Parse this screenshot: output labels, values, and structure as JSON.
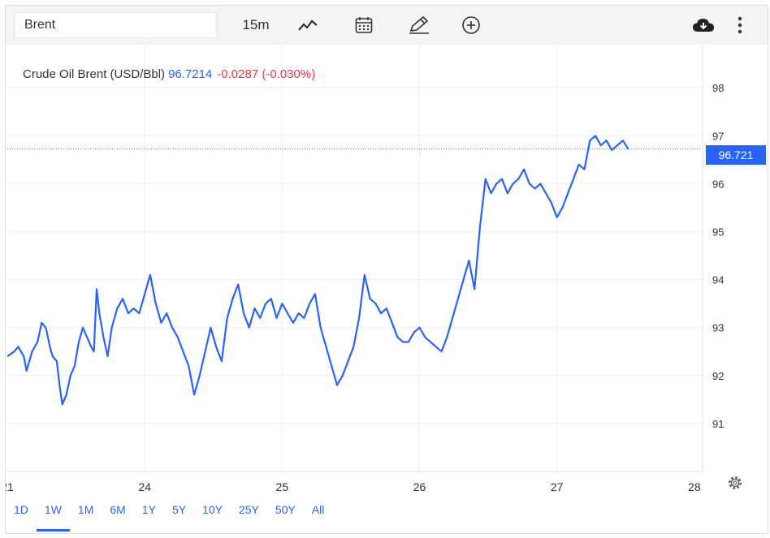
{
  "toolbar": {
    "symbol": "Brent",
    "interval": "15m",
    "icons": [
      "chart-type-icon",
      "calendar-icon",
      "pencil-icon",
      "add-circle-icon",
      "cloud-download-icon",
      "more-vertical-icon"
    ]
  },
  "legend": {
    "name": "Crude Oil Brent (USD/Bbl)",
    "price": "96.7214",
    "change": "-0.0287 (-0.030%)"
  },
  "price_label": "96.721",
  "colors": {
    "line": "#2962ff",
    "negative": "#f23645",
    "grid": "#eeeeee"
  },
  "ranges": [
    "1D",
    "1W",
    "1M",
    "6M",
    "1Y",
    "5Y",
    "10Y",
    "25Y",
    "50Y",
    "All"
  ],
  "active_range": "1W",
  "chart_data": {
    "type": "line",
    "title": "Crude Oil Brent (USD/Bbl)",
    "x_ticks": [
      "21",
      "24",
      "25",
      "26",
      "27",
      "28"
    ],
    "y_ticks": [
      "91",
      "92",
      "93",
      "94",
      "95",
      "96",
      "97",
      "98"
    ],
    "ylim": [
      90.0,
      98.9
    ],
    "xlim": [
      0,
      5.06
    ],
    "last_value": 96.721,
    "grid": true,
    "series": [
      {
        "values": [
          [
            0.0,
            92.4
          ],
          [
            0.05,
            92.5
          ],
          [
            0.08,
            92.6
          ],
          [
            0.12,
            92.4
          ],
          [
            0.14,
            92.1
          ],
          [
            0.18,
            92.5
          ],
          [
            0.22,
            92.7
          ],
          [
            0.25,
            93.1
          ],
          [
            0.28,
            93.0
          ],
          [
            0.31,
            92.6
          ],
          [
            0.33,
            92.4
          ],
          [
            0.36,
            92.3
          ],
          [
            0.38,
            91.8
          ],
          [
            0.4,
            91.4
          ],
          [
            0.43,
            91.6
          ],
          [
            0.46,
            92.0
          ],
          [
            0.49,
            92.2
          ],
          [
            0.52,
            92.7
          ],
          [
            0.55,
            93.0
          ],
          [
            0.58,
            92.8
          ],
          [
            0.61,
            92.6
          ],
          [
            0.63,
            92.5
          ],
          [
            0.65,
            93.8
          ],
          [
            0.67,
            93.3
          ],
          [
            0.7,
            92.8
          ],
          [
            0.73,
            92.4
          ],
          [
            0.76,
            93.0
          ],
          [
            0.8,
            93.4
          ],
          [
            0.84,
            93.6
          ],
          [
            0.88,
            93.3
          ],
          [
            0.92,
            93.4
          ],
          [
            0.96,
            93.3
          ],
          [
            1.0,
            93.7
          ],
          [
            1.04,
            94.1
          ],
          [
            1.08,
            93.5
          ],
          [
            1.12,
            93.1
          ],
          [
            1.16,
            93.3
          ],
          [
            1.2,
            93.0
          ],
          [
            1.24,
            92.8
          ],
          [
            1.28,
            92.5
          ],
          [
            1.32,
            92.2
          ],
          [
            1.36,
            91.6
          ],
          [
            1.4,
            92.0
          ],
          [
            1.44,
            92.5
          ],
          [
            1.48,
            93.0
          ],
          [
            1.52,
            92.6
          ],
          [
            1.56,
            92.3
          ],
          [
            1.6,
            93.2
          ],
          [
            1.64,
            93.6
          ],
          [
            1.68,
            93.9
          ],
          [
            1.72,
            93.3
          ],
          [
            1.76,
            93.0
          ],
          [
            1.8,
            93.4
          ],
          [
            1.84,
            93.2
          ],
          [
            1.88,
            93.5
          ],
          [
            1.92,
            93.6
          ],
          [
            1.96,
            93.2
          ],
          [
            2.0,
            93.5
          ],
          [
            2.04,
            93.3
          ],
          [
            2.08,
            93.1
          ],
          [
            2.12,
            93.3
          ],
          [
            2.16,
            93.2
          ],
          [
            2.2,
            93.5
          ],
          [
            2.24,
            93.7
          ],
          [
            2.28,
            93.0
          ],
          [
            2.32,
            92.6
          ],
          [
            2.36,
            92.2
          ],
          [
            2.4,
            91.8
          ],
          [
            2.44,
            92.0
          ],
          [
            2.48,
            92.3
          ],
          [
            2.52,
            92.6
          ],
          [
            2.56,
            93.2
          ],
          [
            2.6,
            94.1
          ],
          [
            2.64,
            93.6
          ],
          [
            2.68,
            93.5
          ],
          [
            2.72,
            93.3
          ],
          [
            2.76,
            93.4
          ],
          [
            2.8,
            93.1
          ],
          [
            2.84,
            92.8
          ],
          [
            2.88,
            92.7
          ],
          [
            2.92,
            92.7
          ],
          [
            2.96,
            92.9
          ],
          [
            3.0,
            93.0
          ],
          [
            3.04,
            92.8
          ],
          [
            3.08,
            92.7
          ],
          [
            3.12,
            92.6
          ],
          [
            3.16,
            92.5
          ],
          [
            3.2,
            92.8
          ],
          [
            3.24,
            93.2
          ],
          [
            3.28,
            93.6
          ],
          [
            3.32,
            94.0
          ],
          [
            3.36,
            94.4
          ],
          [
            3.4,
            93.8
          ],
          [
            3.44,
            95.1
          ],
          [
            3.48,
            96.1
          ],
          [
            3.52,
            95.8
          ],
          [
            3.56,
            96.0
          ],
          [
            3.6,
            96.1
          ],
          [
            3.64,
            95.8
          ],
          [
            3.68,
            96.0
          ],
          [
            3.72,
            96.1
          ],
          [
            3.76,
            96.3
          ],
          [
            3.8,
            96.0
          ],
          [
            3.84,
            95.9
          ],
          [
            3.88,
            96.0
          ],
          [
            3.92,
            95.8
          ],
          [
            3.96,
            95.6
          ],
          [
            4.0,
            95.3
          ],
          [
            4.04,
            95.5
          ],
          [
            4.08,
            95.8
          ],
          [
            4.12,
            96.1
          ],
          [
            4.16,
            96.4
          ],
          [
            4.2,
            96.3
          ],
          [
            4.24,
            96.9
          ],
          [
            4.28,
            97.0
          ],
          [
            4.32,
            96.8
          ],
          [
            4.36,
            96.9
          ],
          [
            4.4,
            96.7
          ],
          [
            4.44,
            96.8
          ],
          [
            4.48,
            96.9
          ],
          [
            4.52,
            96.721
          ]
        ]
      }
    ]
  }
}
